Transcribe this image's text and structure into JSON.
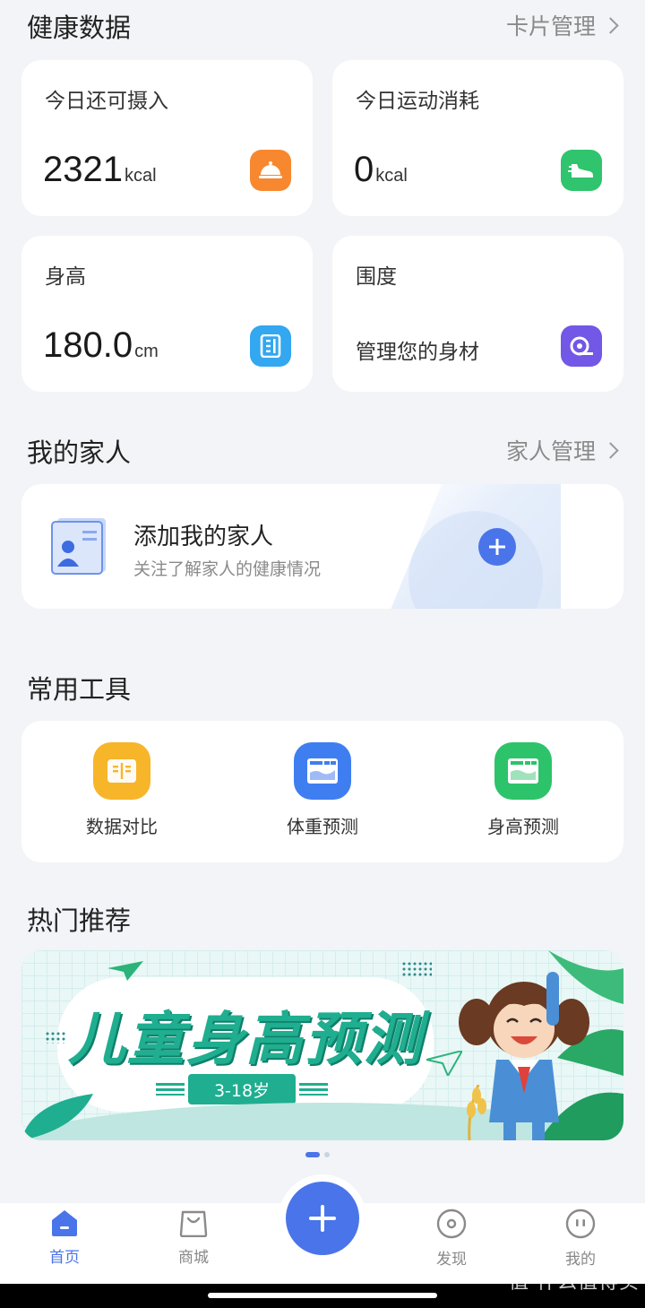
{
  "health": {
    "title": "健康数据",
    "manage_link": "卡片管理",
    "cards": {
      "intake": {
        "title": "今日还可摄入",
        "value": "2321",
        "unit": "kcal",
        "icon": "cloche-icon",
        "color": "#f7882f"
      },
      "exercise": {
        "title": "今日运动消耗",
        "value": "0",
        "unit": "kcal",
        "icon": "running-shoe-icon",
        "color": "#2fc46d"
      },
      "height": {
        "title": "身高",
        "value": "180.0",
        "unit": "cm",
        "icon": "ruler-icon",
        "color": "#33a7f0"
      },
      "girth": {
        "title": "围度",
        "text": "管理您的身材",
        "icon": "tape-measure-icon",
        "color": "#7357e6"
      }
    }
  },
  "family": {
    "title": "我的家人",
    "manage_link": "家人管理",
    "add_title": "添加我的家人",
    "add_subtitle": "关注了解家人的健康情况"
  },
  "tools": {
    "title": "常用工具",
    "items": [
      {
        "label": "数据对比",
        "icon": "compare-icon",
        "color": "#f7b52a"
      },
      {
        "label": "体重预测",
        "icon": "weight-chart-icon",
        "color": "#3f7ef0"
      },
      {
        "label": "身高预测",
        "icon": "height-chart-icon",
        "color": "#2dc36a"
      }
    ]
  },
  "recommend": {
    "title": "热门推荐",
    "banner_title": "儿童身高预测",
    "banner_subtitle": "3-18岁",
    "carousel_pages": 2,
    "carousel_active": 1
  },
  "nav": {
    "home": "首页",
    "shop": "商城",
    "discover": "发现",
    "mine": "我的"
  },
  "watermark": "值 什么值得买"
}
